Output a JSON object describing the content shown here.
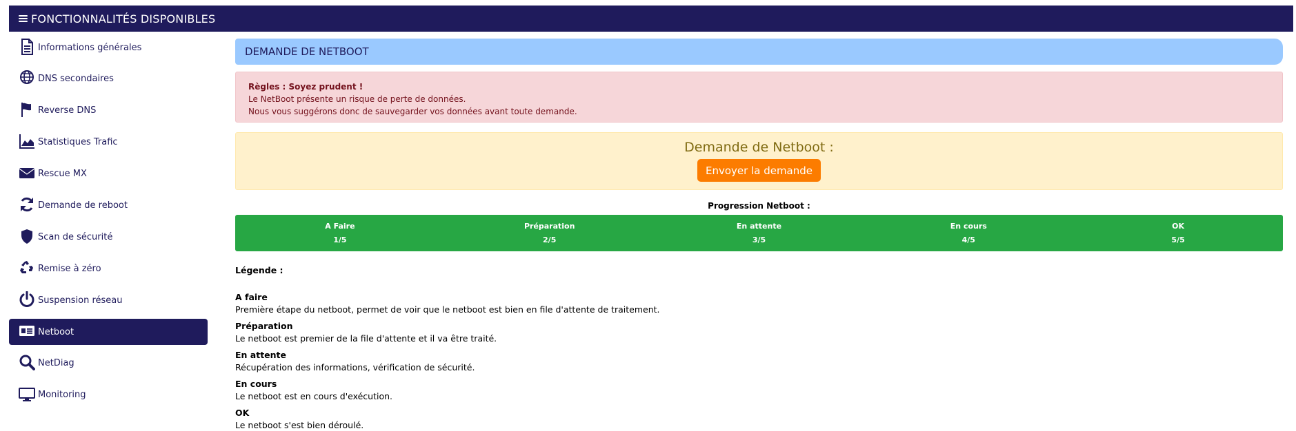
{
  "header": {
    "title": "FONCTIONNALITÉS DISPONIBLES",
    "menu_icon": "hamburger-icon"
  },
  "sidebar": {
    "items": [
      {
        "label": "Informations générales",
        "icon": "document-icon"
      },
      {
        "label": "DNS secondaires",
        "icon": "globe-icon"
      },
      {
        "label": "Reverse DNS",
        "icon": "flag-icon"
      },
      {
        "label": "Statistiques Trafic",
        "icon": "area-chart-icon"
      },
      {
        "label": "Rescue MX",
        "icon": "envelope-icon"
      },
      {
        "label": "Demande de reboot",
        "icon": "refresh-icon"
      },
      {
        "label": "Scan de sécurité",
        "icon": "shield-icon"
      },
      {
        "label": "Remise à zéro",
        "icon": "recycle-icon"
      },
      {
        "label": "Suspension réseau",
        "icon": "power-icon"
      },
      {
        "label": "Netboot",
        "icon": "id-card-icon",
        "active": true
      },
      {
        "label": "NetDiag",
        "icon": "search-icon"
      },
      {
        "label": "Monitoring",
        "icon": "desktop-icon"
      }
    ]
  },
  "main": {
    "panel_title": "DEMANDE DE NETBOOT",
    "rules": {
      "title": "Règles : Soyez prudent !",
      "line1": "Le NetBoot présente un risque de perte de données.",
      "line2": "Nous vous suggérons donc de sauvegarder vos données avant toute demande."
    },
    "request": {
      "title": "Demande de Netboot :",
      "button_label": "Envoyer la demande"
    },
    "progress": {
      "title": "Progression Netboot :",
      "steps": [
        {
          "label": "A Faire",
          "value": "1/5"
        },
        {
          "label": "Préparation",
          "value": "2/5"
        },
        {
          "label": "En attente",
          "value": "3/5"
        },
        {
          "label": "En cours",
          "value": "4/5"
        },
        {
          "label": "OK",
          "value": "5/5"
        }
      ]
    },
    "legend": {
      "title": "Légende :",
      "items": [
        {
          "term": "A faire",
          "desc": "Première étape du netboot, permet de voir que le netboot est bien en file d'attente de traitement."
        },
        {
          "term": "Préparation",
          "desc": "Le netboot est premier de la file d'attente et il va être traité."
        },
        {
          "term": "En attente",
          "desc": "Récupération des informations, vérification de sécurité."
        },
        {
          "term": "En cours",
          "desc": "Le netboot est en cours d'exécution."
        },
        {
          "term": "OK",
          "desc": "Le netboot s'est bien déroulé."
        }
      ]
    }
  },
  "colors": {
    "navy": "#1f1b5c",
    "panel_blue": "#9ac9ff",
    "danger_bg": "#f6d6d9",
    "warn_bg": "#fff1cc",
    "orange": "#fc7c00",
    "success": "#27a744"
  }
}
